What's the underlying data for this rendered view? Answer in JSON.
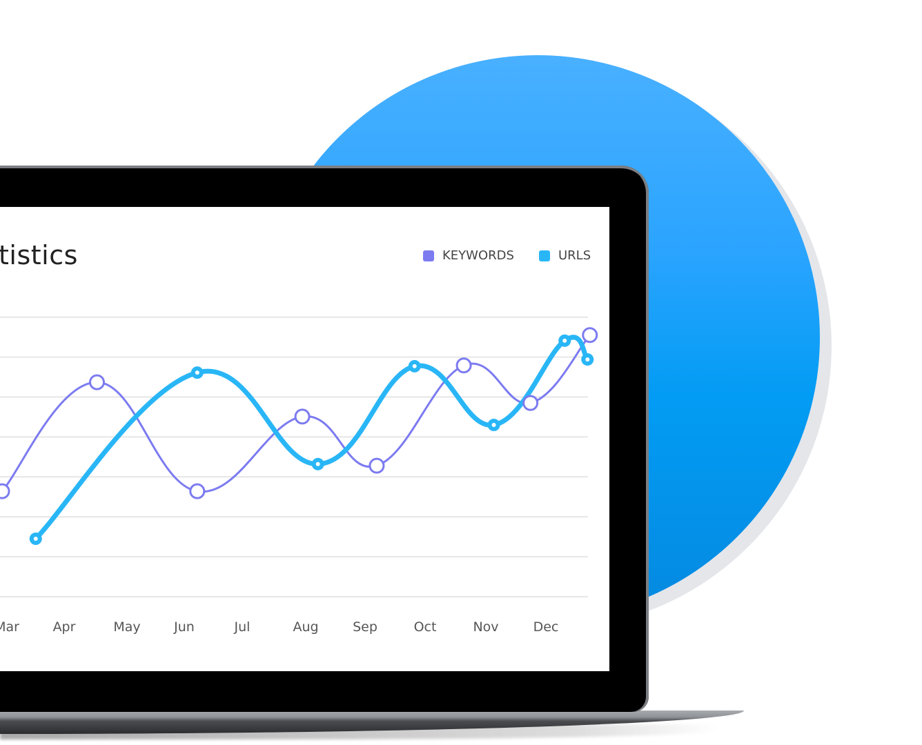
{
  "colors": {
    "keywords": "#7c7bf0",
    "urls": "#29b6f6",
    "circle": "#1fa3ff",
    "bezel": "#000000"
  },
  "chart_data": {
    "type": "line",
    "title": "tistics",
    "xlabel": "",
    "ylabel": "",
    "categories": [
      "Mar",
      "Apr",
      "May",
      "Jun",
      "Jul",
      "Aug",
      "Sep",
      "Oct",
      "Nov",
      "Dec"
    ],
    "ylim": [
      0,
      7
    ],
    "grid": true,
    "legend": "top-right",
    "smooth": true,
    "series": [
      {
        "name": "KEYWORDS",
        "points": [
          [
            -0.08,
            2.64
          ],
          [
            1.5,
            5.37
          ],
          [
            3.17,
            2.64
          ],
          [
            4.92,
            4.51
          ],
          [
            6.16,
            3.28
          ],
          [
            7.61,
            5.79
          ],
          [
            8.72,
            4.85
          ],
          [
            9.71,
            6.55
          ]
        ]
      },
      {
        "name": "URLS",
        "points": [
          [
            0.48,
            1.45
          ],
          [
            3.17,
            5.61
          ],
          [
            5.18,
            3.32
          ],
          [
            6.79,
            5.77
          ],
          [
            8.11,
            4.3
          ],
          [
            9.29,
            6.41
          ],
          [
            9.67,
            5.94
          ]
        ]
      }
    ]
  }
}
